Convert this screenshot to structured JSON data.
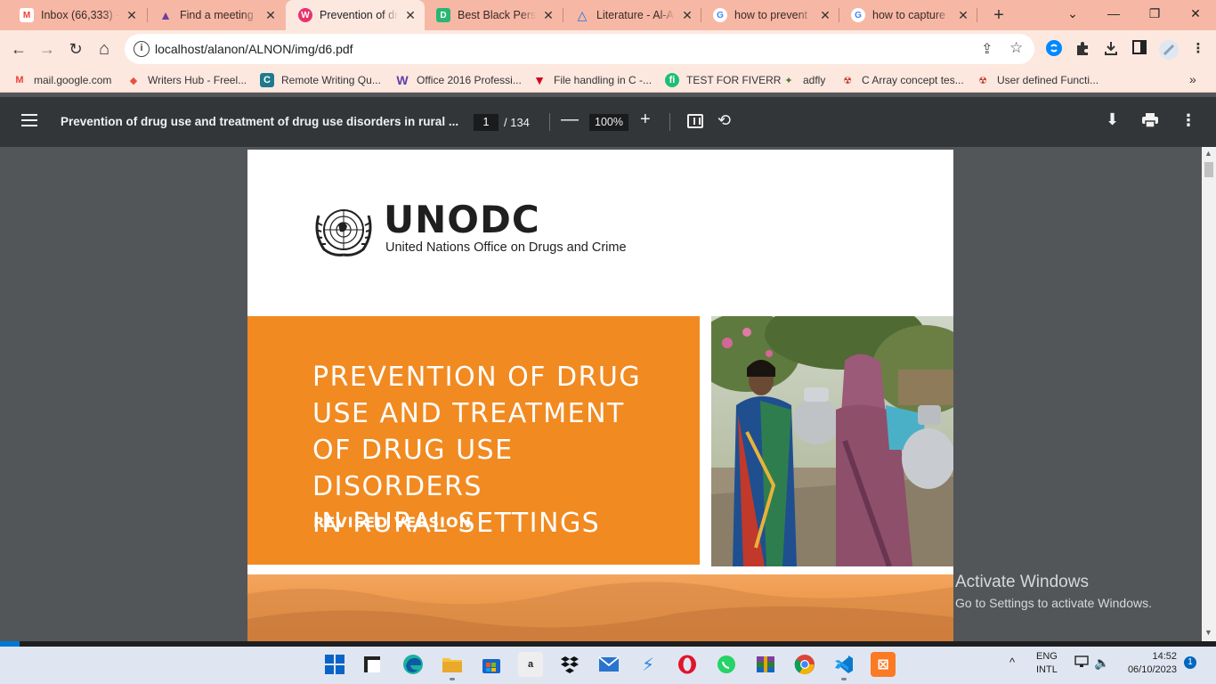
{
  "browser": {
    "tabs": [
      {
        "label": "Inbox (66,333) -",
        "icon": "gmail-icon",
        "color": "#ea4335"
      },
      {
        "label": "Find a meeting -",
        "icon": "triangle-app-icon",
        "color": "#6b3fa0"
      },
      {
        "label": "Prevention of dr",
        "icon": "pdf-app-icon",
        "color": "#e8336d"
      },
      {
        "label": "Best Black Perso",
        "icon": "doc-app-icon",
        "color": "#2bb673"
      },
      {
        "label": "Literature - Al-A",
        "icon": "literature-app-icon",
        "color": "#1a73e8"
      },
      {
        "label": "how to prevent",
        "icon": "google-icon",
        "color": "#4285f4"
      },
      {
        "label": "how to capture",
        "icon": "google-icon",
        "color": "#4285f4"
      }
    ],
    "active_tab_index": 2,
    "new_tab": "+",
    "window_controls": {
      "minimize": "—",
      "restore": "❐",
      "close": "✕",
      "tab_search": "⌄"
    }
  },
  "toolbar": {
    "back": "←",
    "forward": "→",
    "reload": "↻",
    "home": "⌂",
    "url": "localhost/alanon/ALNON/img/d6.pdf",
    "site_info": "i",
    "share": "⇪",
    "bookmark_star": "☆",
    "extensions": [
      "shazam-icon",
      "puzzle-extensions-icon",
      "download-icon",
      "sidepanel-icon",
      "profile-icon"
    ]
  },
  "bookmarks": [
    {
      "label": "mail.google.com",
      "icon": "gmail-icon",
      "glyph": "M",
      "color": "#ea4335"
    },
    {
      "label": "Writers Hub - Freel...",
      "icon": "writers-hub-icon",
      "glyph": "◆",
      "color": "#e5533d"
    },
    {
      "label": "Remote Writing Qu...",
      "icon": "remote-writing-icon",
      "glyph": "C",
      "color": "#1f7a8c"
    },
    {
      "label": "Office 2016 Professi...",
      "icon": "office-w-icon",
      "glyph": "W",
      "color": "#5b3fa8"
    },
    {
      "label": "File handling in C -...",
      "icon": "triangle-down-icon",
      "glyph": "▼",
      "color": "#d6001c"
    },
    {
      "label": "TEST FOR FIVERR",
      "icon": "fiverr-icon",
      "glyph": "fi",
      "color": "#1dbf73"
    },
    {
      "label": "adfly",
      "icon": "adfly-icon",
      "glyph": "✦",
      "color": "#4a7a2c"
    },
    {
      "label": "C Array concept tes...",
      "icon": "c-array-icon",
      "glyph": "☢",
      "color": "#c0392b"
    },
    {
      "label": "User defined Functi...",
      "icon": "user-fn-icon",
      "glyph": "☢",
      "color": "#c0392b"
    }
  ],
  "bookmarks_more": "»",
  "pdf": {
    "title": "Prevention of drug use and treatment of drug use disorders in rural ...",
    "page_current": "1",
    "page_total": "/ 134",
    "zoom": "100%",
    "zoom_out": "—",
    "zoom_in": "+",
    "rotate": "⟲",
    "download": "⬇",
    "more": "⋮"
  },
  "cover": {
    "brand": "UNODC",
    "brand_sub": "United Nations Office on Drugs and Crime",
    "title_lines": [
      "PREVENTION OF DRUG",
      "USE AND TREATMENT",
      "OF DRUG USE DISORDERS",
      "IN RURAL SETTINGS"
    ],
    "subtitle": "REVISED VERSION"
  },
  "activate_windows": {
    "line1": "Activate Windows",
    "line2": "Go to Settings to activate Windows."
  },
  "taskbar": {
    "apps": [
      "windows-start-icon",
      "file-explorer-dark-icon",
      "edge-icon",
      "folder-icon",
      "store-icon",
      "amazon-icon",
      "dropbox-icon",
      "mail-icon",
      "vscode-blue-icon",
      "opera-icon",
      "whatsapp-icon",
      "winrar-icon",
      "chrome-icon",
      "vscode-icon",
      "xampp-icon"
    ],
    "tray_chevron": "^",
    "lang_line1": "ENG",
    "lang_line2": "INTL",
    "time": "14:52",
    "date": "06/10/2023",
    "notifications": "1"
  }
}
